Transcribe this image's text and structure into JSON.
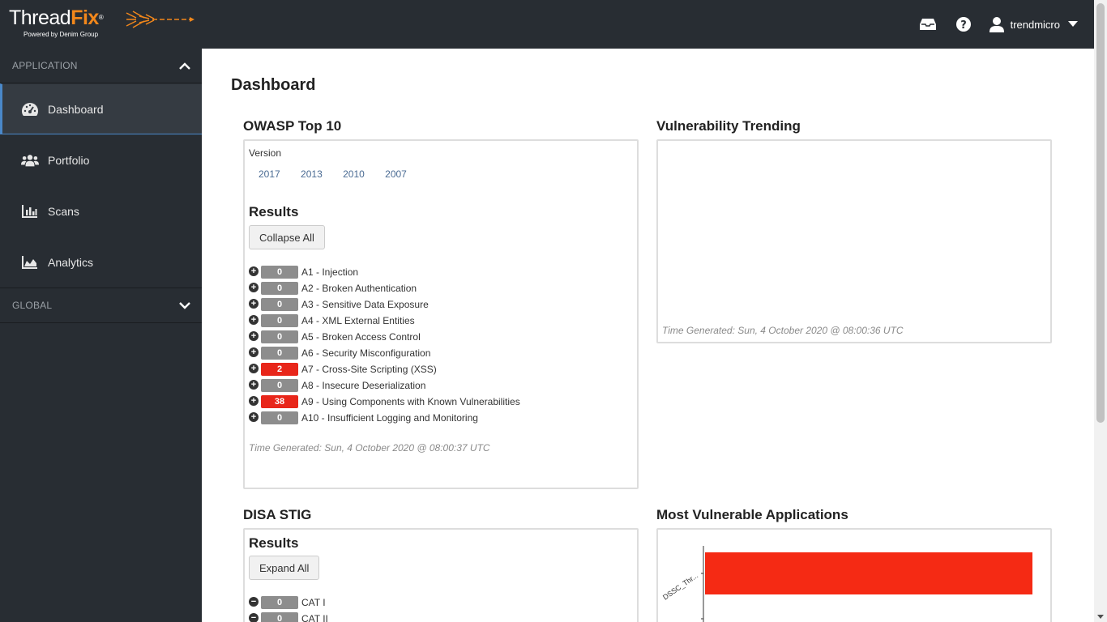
{
  "header": {
    "logo_thread": "Thread",
    "logo_fix": "Fix",
    "logo_reg": "®",
    "logo_sub": "Powered by Denim Group",
    "username": "trendmicro",
    "icons": [
      "inbox-icon",
      "help-icon",
      "user-icon",
      "caret-down-icon"
    ]
  },
  "sidebar": {
    "section_application": "APPLICATION",
    "section_global": "GLOBAL",
    "items": [
      {
        "label": "Dashboard",
        "icon": "dashboard-icon",
        "active": true
      },
      {
        "label": "Portfolio",
        "icon": "users-icon",
        "active": false
      },
      {
        "label": "Scans",
        "icon": "bar-chart-icon",
        "active": false
      },
      {
        "label": "Analytics",
        "icon": "area-chart-icon",
        "active": false
      }
    ]
  },
  "main": {
    "title": "Dashboard",
    "owasp": {
      "title": "OWASP Top 10",
      "version_label": "Version",
      "versions": [
        "2017",
        "2013",
        "2010",
        "2007"
      ],
      "results_label": "Results",
      "collapse_label": "Collapse All",
      "rows": [
        {
          "count": "0",
          "label": "A1 - Injection",
          "highlight": false
        },
        {
          "count": "0",
          "label": "A2 - Broken Authentication",
          "highlight": false
        },
        {
          "count": "0",
          "label": "A3 - Sensitive Data Exposure",
          "highlight": false
        },
        {
          "count": "0",
          "label": "A4 - XML External Entities",
          "highlight": false
        },
        {
          "count": "0",
          "label": "A5 - Broken Access Control",
          "highlight": false
        },
        {
          "count": "0",
          "label": "A6 - Security Misconfiguration",
          "highlight": false
        },
        {
          "count": "2",
          "label": "A7 - Cross-Site Scripting (XSS)",
          "highlight": true
        },
        {
          "count": "0",
          "label": "A8 - Insecure Deserialization",
          "highlight": false
        },
        {
          "count": "38",
          "label": "A9 - Using Components with Known Vulnerabilities",
          "highlight": true
        },
        {
          "count": "0",
          "label": "A10 - Insufficient Logging and Monitoring",
          "highlight": false
        }
      ],
      "time_generated": "Time Generated: Sun, 4 October 2020 @ 08:00:37 UTC"
    },
    "trending": {
      "title": "Vulnerability Trending",
      "time_generated": "Time Generated: Sun, 4 October 2020 @ 08:00:36 UTC"
    },
    "disa": {
      "title": "DISA STIG",
      "results_label": "Results",
      "expand_label": "Expand All",
      "rows": [
        {
          "count": "0",
          "label": "CAT I"
        },
        {
          "count": "0",
          "label": "CAT II"
        }
      ]
    },
    "most_vulnerable": {
      "title": "Most Vulnerable Applications",
      "bar_color": "#f52a14"
    }
  },
  "chart_data": {
    "type": "bar",
    "categories": [
      "DSSC_Thr..."
    ],
    "values": [
      40
    ],
    "title": "Most Vulnerable Applications"
  }
}
